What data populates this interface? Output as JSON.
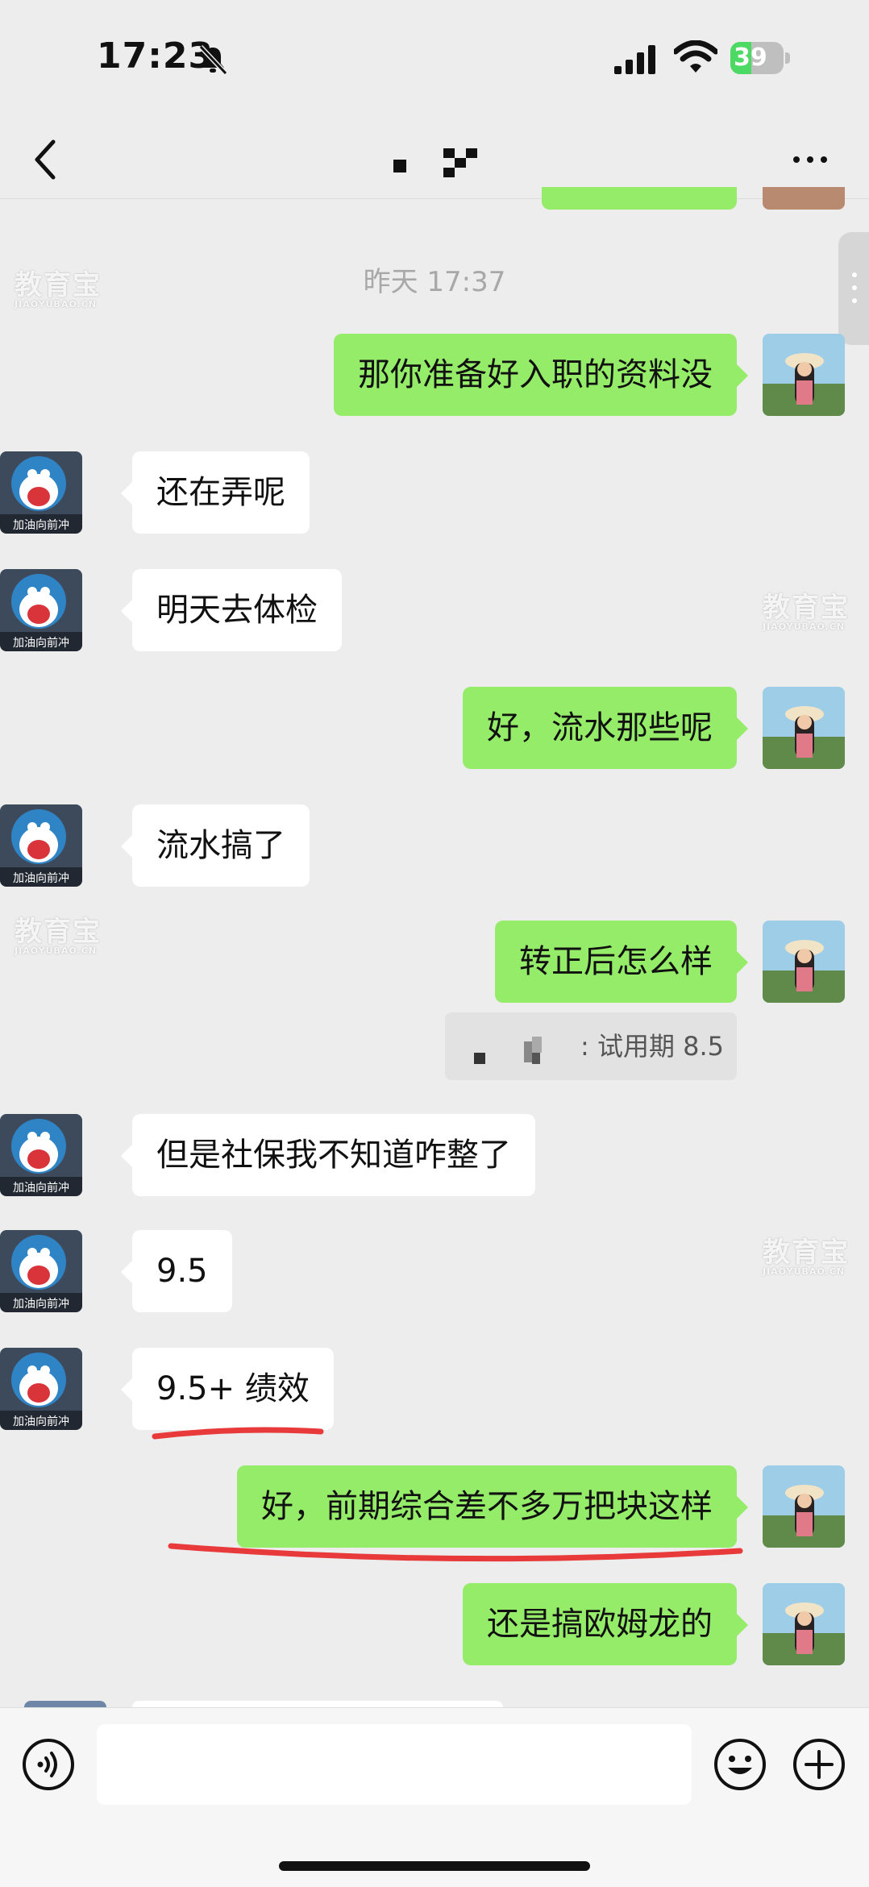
{
  "status_bar": {
    "time": "17:23",
    "battery_percent": "39",
    "battery_level": 0.39
  },
  "nav": {
    "title_obscured": true
  },
  "timestamp": "昨天 17:37",
  "avatar_caption": "加油向前冲",
  "watermark": {
    "text": "教育宝",
    "sub": "JIAOYUBAO.CN"
  },
  "messages": [
    {
      "side": "right",
      "text": "那你准备好入职的资料没"
    },
    {
      "side": "left",
      "text": "还在弄呢"
    },
    {
      "side": "left",
      "text": "明天去体检"
    },
    {
      "side": "right",
      "text": "好，流水那些呢"
    },
    {
      "side": "left",
      "text": "流水搞了"
    },
    {
      "side": "right",
      "text": "转正后怎么样"
    },
    {
      "side": "left",
      "text": "但是社保我不知道咋整了"
    },
    {
      "side": "left",
      "text": "9.5"
    },
    {
      "side": "left",
      "text": "9.5+ 绩效"
    },
    {
      "side": "right",
      "text": "好，前期综合差不多万把块这样"
    },
    {
      "side": "right",
      "text": "还是搞欧姆龙的"
    }
  ],
  "quote": {
    "suffix": ": 试用期 8.5"
  },
  "input": {
    "value": "",
    "placeholder": ""
  },
  "colors": {
    "background": "#ededed",
    "bubble_self": "#95ec69",
    "bubble_other": "#ffffff",
    "annotation_red": "#e83a3a"
  },
  "icons": [
    "bell-slash-icon",
    "signal-icon",
    "wifi-icon",
    "battery-icon",
    "back-chevron-icon",
    "more-dots-icon",
    "voice-icon",
    "emoji-icon",
    "plus-icon"
  ]
}
